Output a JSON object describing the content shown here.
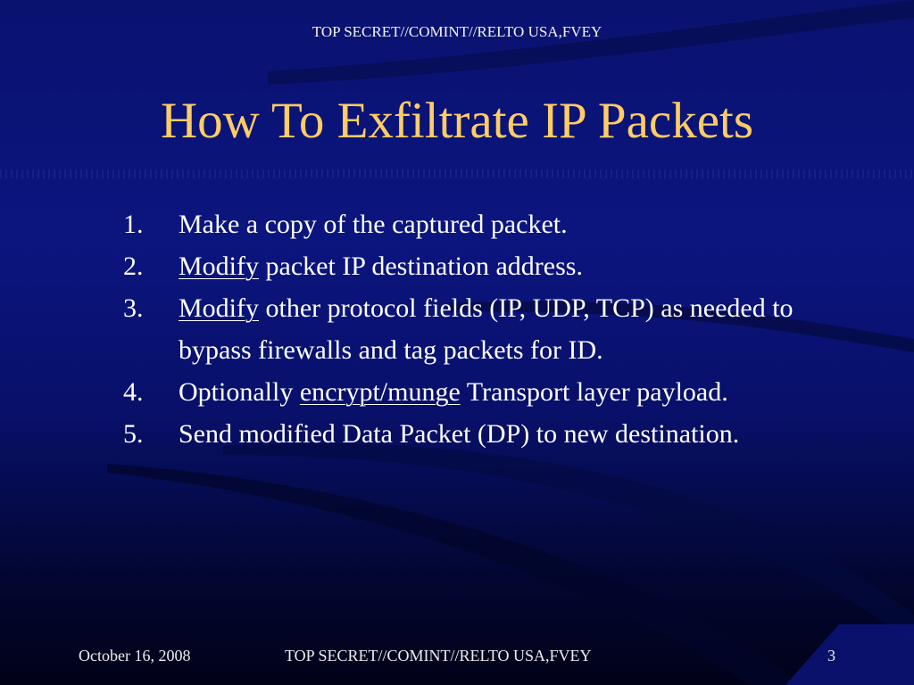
{
  "header": {
    "classification": "TOP SECRET//COMINT//RELTO USA,FVEY"
  },
  "slide": {
    "title": "How To Exfiltrate IP Packets",
    "items": [
      {
        "number": "1.",
        "segments": [
          {
            "text": "Make a copy of the captured packet.",
            "underline": false
          }
        ]
      },
      {
        "number": "2.",
        "segments": [
          {
            "text": "Modify",
            "underline": true
          },
          {
            "text": " packet IP destination address.",
            "underline": false
          }
        ]
      },
      {
        "number": "3.",
        "segments": [
          {
            "text": "Modify",
            "underline": true
          },
          {
            "text": " other protocol fields (IP, UDP, TCP) as needed to bypass firewalls and tag packets for ID.",
            "underline": false
          }
        ]
      },
      {
        "number": "4.",
        "segments": [
          {
            "text": "Optionally ",
            "underline": false
          },
          {
            "text": "encrypt/munge",
            "underline": true
          },
          {
            "text": " Transport layer payload.",
            "underline": false
          }
        ]
      },
      {
        "number": "5.",
        "segments": [
          {
            "text": "Send modified Data Packet (DP) to new destination.",
            "underline": false
          }
        ]
      }
    ]
  },
  "footer": {
    "date": "October 16, 2008",
    "classification": "TOP SECRET//COMINT//RELTO USA,FVEY",
    "page_number": "3"
  },
  "colors": {
    "title": "#ffcc66",
    "background": "#0b157e",
    "text": "#ffffff"
  }
}
